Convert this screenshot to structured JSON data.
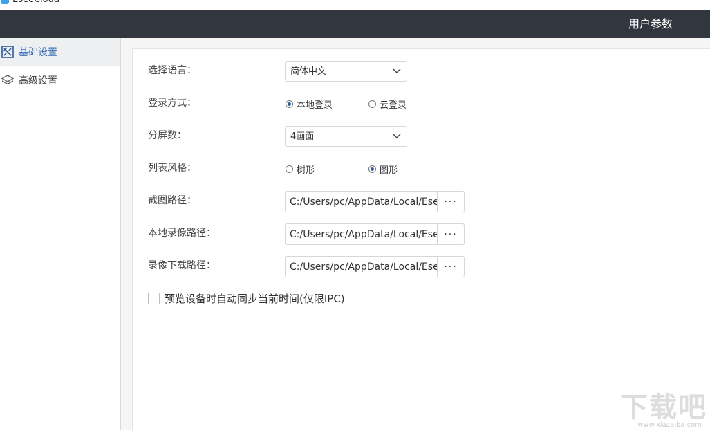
{
  "app": {
    "title": "EseeCloud",
    "header_title": "用户参数"
  },
  "sidebar": {
    "items": [
      {
        "label": "基础设置",
        "icon": "basic-settings-icon",
        "active": true
      },
      {
        "label": "高级设置",
        "icon": "layers-icon",
        "active": false
      }
    ]
  },
  "form": {
    "language": {
      "label": "选择语言：",
      "value": "简体中文"
    },
    "login_mode": {
      "label": "登录方式：",
      "options": [
        {
          "label": "本地登录",
          "selected": true
        },
        {
          "label": "云登录",
          "selected": false
        }
      ]
    },
    "split_screen": {
      "label": "分屏数：",
      "value": "4画面"
    },
    "list_style": {
      "label": "列表风格：",
      "options": [
        {
          "label": "树形",
          "selected": false
        },
        {
          "label": "图形",
          "selected": true
        }
      ]
    },
    "snapshot_path": {
      "label": "截图路径：",
      "value": "C:/Users/pc/AppData/Local/EseeCloud",
      "browse": "···"
    },
    "record_path": {
      "label": "本地录像路径：",
      "value": "C:/Users/pc/AppData/Local/EseeCloud",
      "browse": "···"
    },
    "download_path": {
      "label": "录像下载路径：",
      "value": "C:/Users/pc/AppData/Local/EseeCloud",
      "browse": "···"
    },
    "sync_time": {
      "label": "预览设备时自动同步当前时间(仅限IPC)",
      "checked": false
    }
  },
  "watermark": {
    "text": "下载吧",
    "sub": "www.xiazaiba.com"
  },
  "colors": {
    "header_bg": "#32373f",
    "accent": "#3b6fb6",
    "panel_bg": "#f5f5f6"
  }
}
